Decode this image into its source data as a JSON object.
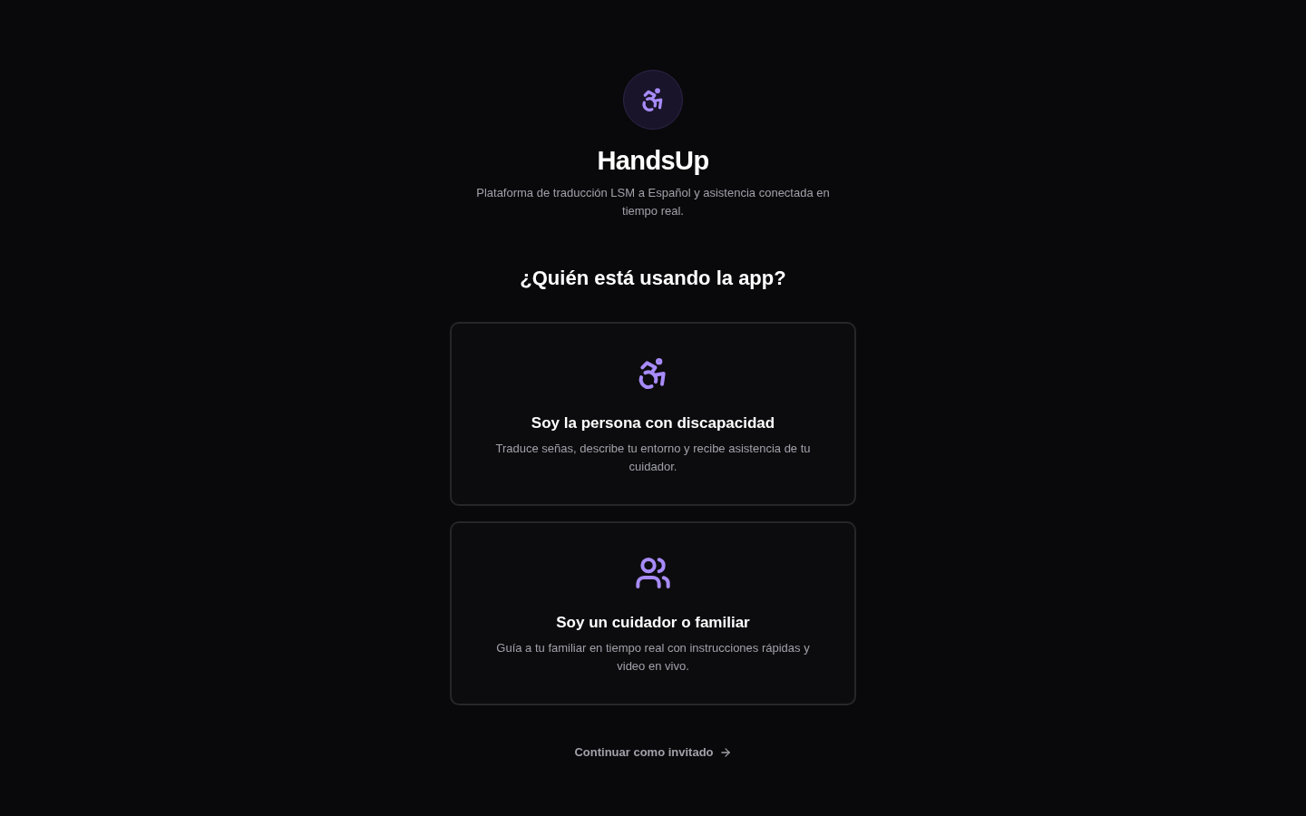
{
  "app": {
    "name": "HandsUp",
    "tagline": "Plataforma de traducción LSM a Español y asistencia conectada en tiempo real."
  },
  "prompt": "¿Quién está usando la app?",
  "roles": [
    {
      "kind": "person",
      "title": "Soy la persona con discapacidad",
      "description": "Traduce señas, describe tu entorno y recibe asistencia de tu cuidador."
    },
    {
      "kind": "caregiver",
      "title": "Soy un cuidador o familiar",
      "description": "Guía a tu familiar en tiempo real con instrucciones rápidas y video en vivo."
    }
  ],
  "guest_link": {
    "label": "Continuar como invitado"
  }
}
